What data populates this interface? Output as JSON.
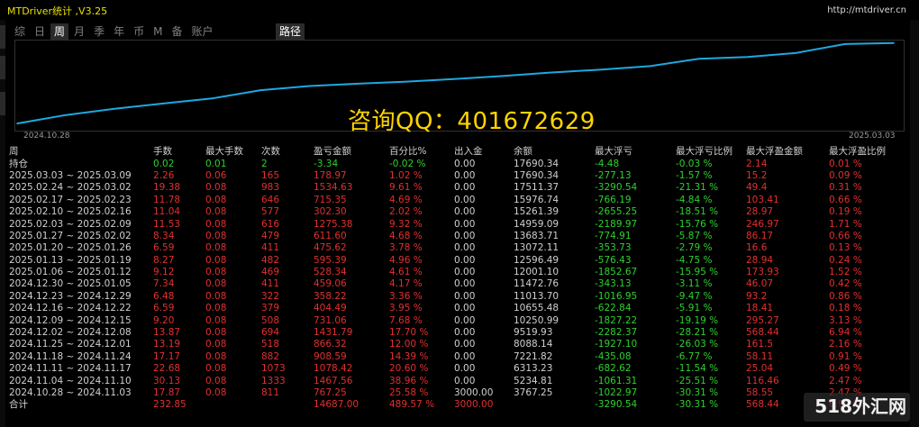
{
  "app": {
    "title": "MTDriver统计 ,V3.25",
    "url": "http://mtdriver.cn"
  },
  "tabs": [
    {
      "label": "综"
    },
    {
      "label": "日"
    },
    {
      "label": "周",
      "active": true
    },
    {
      "label": "月"
    },
    {
      "label": "季"
    },
    {
      "label": "年"
    },
    {
      "label": "币"
    },
    {
      "label": "M"
    },
    {
      "label": "备"
    },
    {
      "label": "账户"
    }
  ],
  "route_tab": "路径",
  "chart": {
    "start_date": "2024.10.28",
    "end_date": "2025.03.03",
    "line_color": "#1ea8e0"
  },
  "chart_data": {
    "type": "line",
    "x": [
      "2024.10.28",
      "2024.11.04",
      "2024.11.11",
      "2024.11.18",
      "2024.11.25",
      "2024.12.02",
      "2024.12.09",
      "2024.12.16",
      "2024.12.23",
      "2024.12.30",
      "2025.01.06",
      "2025.01.13",
      "2025.01.20",
      "2025.01.27",
      "2025.02.03",
      "2025.02.10",
      "2025.02.17",
      "2025.02.24",
      "2025.03.03"
    ],
    "y": [
      3767.25,
      5234.81,
      6313.23,
      7221.82,
      8088.14,
      9519.93,
      10250.99,
      10655.48,
      11013.7,
      11472.76,
      12001.1,
      12596.49,
      13072.11,
      13683.71,
      14959.09,
      15261.39,
      15976.74,
      17511.37,
      17690.34
    ]
  },
  "watermark": "咨询QQ：401672629",
  "brand": "518外汇网",
  "table": {
    "headers": [
      "周",
      "手数",
      "最大手数",
      "次数",
      "盈亏金额",
      "百分比%",
      "出入金",
      "余额",
      "最大浮亏",
      "最大浮亏比例",
      "最大浮盈金额",
      "最大浮盈比例"
    ],
    "holding": [
      "持仓",
      "0.02",
      "0.01",
      "2",
      "-3.34",
      "-0.02 %",
      "0.00",
      "17690.34",
      "-4.48",
      "-0.03 %",
      "2.14",
      "0.01 %"
    ],
    "rows": [
      [
        "2025.03.03 ~ 2025.03.09",
        "2.26",
        "0.06",
        "165",
        "178.97",
        "1.02 %",
        "0.00",
        "17690.34",
        "-277.13",
        "-1.57 %",
        "15.2",
        "0.09 %"
      ],
      [
        "2025.02.24 ~ 2025.03.02",
        "19.38",
        "0.08",
        "983",
        "1534.63",
        "9.61 %",
        "0.00",
        "17511.37",
        "-3290.54",
        "-21.31 %",
        "49.4",
        "0.31 %"
      ],
      [
        "2025.02.17 ~ 2025.02.23",
        "11.78",
        "0.08",
        "646",
        "715.35",
        "4.69 %",
        "0.00",
        "15976.74",
        "-766.19",
        "-4.84 %",
        "103.41",
        "0.66 %"
      ],
      [
        "2025.02.10 ~ 2025.02.16",
        "11.04",
        "0.08",
        "577",
        "302.30",
        "2.02 %",
        "0.00",
        "15261.39",
        "-2655.25",
        "-18.51 %",
        "28.97",
        "0.19 %"
      ],
      [
        "2025.02.03 ~ 2025.02.09",
        "11.53",
        "0.08",
        "616",
        "1275.38",
        "9.32 %",
        "0.00",
        "14959.09",
        "-2189.97",
        "-15.76 %",
        "246.97",
        "1.71 %"
      ],
      [
        "2025.01.27 ~ 2025.02.02",
        "8.34",
        "0.08",
        "479",
        "611.60",
        "4.68 %",
        "0.00",
        "13683.71",
        "-774.91",
        "-5.87 %",
        "86.17",
        "0.66 %"
      ],
      [
        "2025.01.20 ~ 2025.01.26",
        "6.59",
        "0.08",
        "411",
        "475.62",
        "3.78 %",
        "0.00",
        "13072.11",
        "-353.73",
        "-2.79 %",
        "16.6",
        "0.13 %"
      ],
      [
        "2025.01.13 ~ 2025.01.19",
        "8.27",
        "0.08",
        "482",
        "595.39",
        "4.96 %",
        "0.00",
        "12596.49",
        "-576.43",
        "-4.75 %",
        "28.94",
        "0.24 %"
      ],
      [
        "2025.01.06 ~ 2025.01.12",
        "9.12",
        "0.08",
        "469",
        "528.34",
        "4.61 %",
        "0.00",
        "12001.10",
        "-1852.67",
        "-15.95 %",
        "173.93",
        "1.52 %"
      ],
      [
        "2024.12.30 ~ 2025.01.05",
        "7.34",
        "0.08",
        "411",
        "459.06",
        "4.17 %",
        "0.00",
        "11472.76",
        "-343.13",
        "-3.11 %",
        "46.07",
        "0.42 %"
      ],
      [
        "2024.12.23 ~ 2024.12.29",
        "6.48",
        "0.08",
        "322",
        "358.22",
        "3.36 %",
        "0.00",
        "11013.70",
        "-1016.95",
        "-9.47 %",
        "93.2",
        "0.86 %"
      ],
      [
        "2024.12.16 ~ 2024.12.22",
        "6.59",
        "0.08",
        "379",
        "404.49",
        "3.95 %",
        "0.00",
        "10655.48",
        "-622.84",
        "-5.91 %",
        "18.41",
        "0.18 %"
      ],
      [
        "2024.12.09 ~ 2024.12.15",
        "9.20",
        "0.08",
        "508",
        "731.06",
        "7.68 %",
        "0.00",
        "10250.99",
        "-1827.22",
        "-19.19 %",
        "295.27",
        "3.13 %"
      ],
      [
        "2024.12.02 ~ 2024.12.08",
        "13.87",
        "0.08",
        "694",
        "1431.79",
        "17.70 %",
        "0.00",
        "9519.93",
        "-2282.37",
        "-28.21 %",
        "568.44",
        "6.94 %"
      ],
      [
        "2024.11.25 ~ 2024.12.01",
        "13.19",
        "0.08",
        "518",
        "866.32",
        "12.00 %",
        "0.00",
        "8088.14",
        "-1927.10",
        "-26.03 %",
        "161.5",
        "2.16 %"
      ],
      [
        "2024.11.18 ~ 2024.11.24",
        "17.17",
        "0.08",
        "882",
        "908.59",
        "14.39 %",
        "0.00",
        "7221.82",
        "-435.08",
        "-6.77 %",
        "58.11",
        "0.91 %"
      ],
      [
        "2024.11.11 ~ 2024.11.17",
        "22.68",
        "0.08",
        "1073",
        "1078.42",
        "20.60 %",
        "0.00",
        "6313.23",
        "-682.62",
        "-11.54 %",
        "25.04",
        "0.49 %"
      ],
      [
        "2024.11.04 ~ 2024.11.10",
        "30.13",
        "0.08",
        "1333",
        "1467.56",
        "38.96 %",
        "0.00",
        "5234.81",
        "-1061.31",
        "-25.51 %",
        "116.46",
        "2.47 %"
      ],
      [
        "2024.10.28 ~ 2024.11.03",
        "17.87",
        "0.08",
        "811",
        "767.25",
        "25.58 %",
        "3000.00",
        "3767.25",
        "-1022.97",
        "-30.31 %",
        "58.55",
        "2.47 %"
      ]
    ],
    "total": [
      "合计",
      "232.85",
      "",
      "",
      "14687.00",
      "489.57 %",
      "3000.00",
      "",
      "-3290.54",
      "-30.31 %",
      "568.44",
      "6.94 %"
    ]
  }
}
